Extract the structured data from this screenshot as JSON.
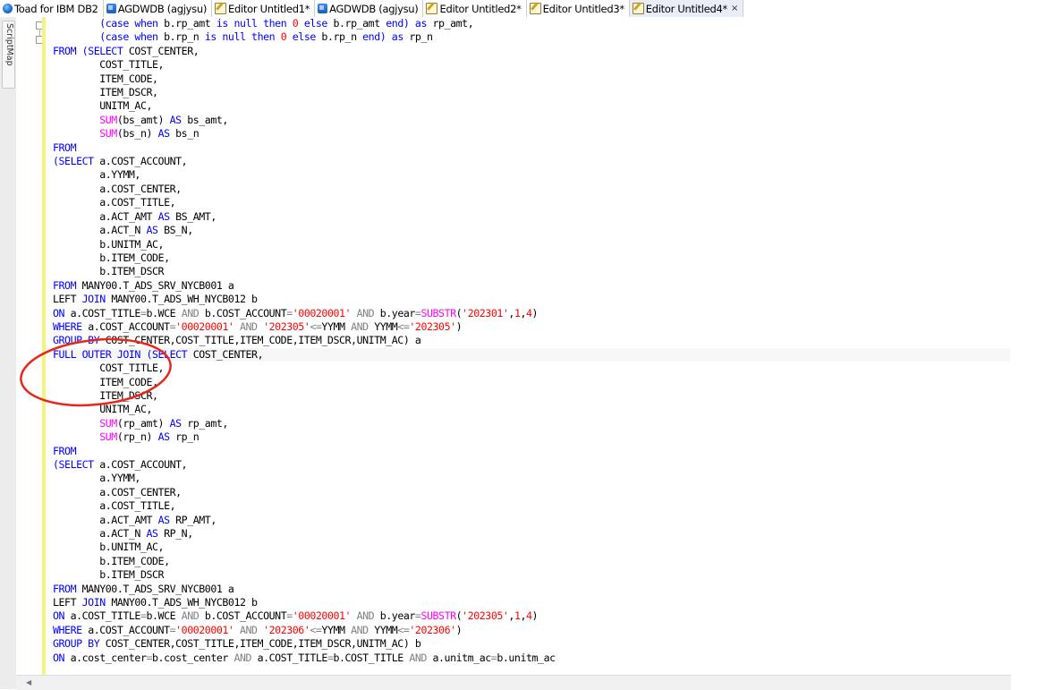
{
  "tabs": [
    {
      "label": "Toad for IBM DB2",
      "icon": "toad-globe-icon",
      "active": false
    },
    {
      "label": "AGDWDB (agjysu)",
      "icon": "database-connection-icon",
      "active": false
    },
    {
      "label": "Editor Untitled1*",
      "icon": "editor-icon",
      "active": false
    },
    {
      "label": "AGDWDB (agjysu)",
      "icon": "database-connection-icon",
      "active": false
    },
    {
      "label": "Editor Untitled2*",
      "icon": "editor-icon",
      "active": false
    },
    {
      "label": "Editor Untitled3*",
      "icon": "editor-icon",
      "active": false
    },
    {
      "label": "Editor Untitled4*",
      "icon": "editor-icon",
      "active": true,
      "close": "×"
    }
  ],
  "scriptmap": {
    "label": "ScriptMap"
  },
  "colors": {
    "keyword": "#0000ff",
    "function": "#ff00ff",
    "string": "#ff0000",
    "number": "#ff0000",
    "operator": "#808080",
    "annotation": "#e8261a",
    "change_bar": "#f5f47a"
  },
  "code": [
    [
      [
        "p",
        "        "
      ],
      [
        "k",
        "(case when "
      ],
      [
        "t",
        "b.rp_amt "
      ],
      [
        "k",
        "is null then "
      ],
      [
        "n",
        "0"
      ],
      [
        "k",
        " else "
      ],
      [
        "t",
        "b.rp_amt "
      ],
      [
        "k",
        "end) as "
      ],
      [
        "t",
        "rp_amt,"
      ]
    ],
    [
      [
        "p",
        "        "
      ],
      [
        "k",
        "(case when "
      ],
      [
        "t",
        "b.rp_n "
      ],
      [
        "k",
        "is null then "
      ],
      [
        "n",
        "0"
      ],
      [
        "k",
        " else "
      ],
      [
        "t",
        "b.rp_n "
      ],
      [
        "k",
        "end) as "
      ],
      [
        "t",
        "rp_n"
      ]
    ],
    [
      [
        "k",
        "FROM "
      ],
      [
        "k",
        "("
      ],
      [
        "k",
        "SELECT "
      ],
      [
        "t",
        "COST_CENTER,"
      ]
    ],
    [
      [
        "p",
        "        "
      ],
      [
        "t",
        "COST_TITLE,"
      ]
    ],
    [
      [
        "p",
        "        "
      ],
      [
        "t",
        "ITEM_CODE,"
      ]
    ],
    [
      [
        "p",
        "        "
      ],
      [
        "t",
        "ITEM_DSCR,"
      ]
    ],
    [
      [
        "p",
        "        "
      ],
      [
        "t",
        "UNITM_AC,"
      ]
    ],
    [
      [
        "p",
        "        "
      ],
      [
        "f",
        "SUM"
      ],
      [
        "t",
        "(bs_amt) "
      ],
      [
        "k",
        "AS "
      ],
      [
        "t",
        "bs_amt,"
      ]
    ],
    [
      [
        "p",
        "        "
      ],
      [
        "f",
        "SUM"
      ],
      [
        "t",
        "(bs_n) "
      ],
      [
        "k",
        "AS "
      ],
      [
        "t",
        "bs_n"
      ]
    ],
    [
      [
        "k",
        "FROM"
      ]
    ],
    [
      [
        "k",
        "(SELECT "
      ],
      [
        "t",
        "a.COST_ACCOUNT,"
      ]
    ],
    [
      [
        "p",
        "        "
      ],
      [
        "t",
        "a.YYMM,"
      ]
    ],
    [
      [
        "p",
        "        "
      ],
      [
        "t",
        "a.COST_CENTER,"
      ]
    ],
    [
      [
        "p",
        "        "
      ],
      [
        "t",
        "a.COST_TITLE,"
      ]
    ],
    [
      [
        "p",
        "        "
      ],
      [
        "t",
        "a.ACT_AMT "
      ],
      [
        "k",
        "AS "
      ],
      [
        "t",
        "BS_AMT,"
      ]
    ],
    [
      [
        "p",
        "        "
      ],
      [
        "t",
        "a.ACT_N "
      ],
      [
        "k",
        "AS "
      ],
      [
        "t",
        "BS_N,"
      ]
    ],
    [
      [
        "p",
        "        "
      ],
      [
        "t",
        "b.UNITM_AC,"
      ]
    ],
    [
      [
        "p",
        "        "
      ],
      [
        "t",
        "b.ITEM_CODE,"
      ]
    ],
    [
      [
        "p",
        "        "
      ],
      [
        "t",
        "b.ITEM_DSCR"
      ]
    ],
    [
      [
        "k",
        "FROM "
      ],
      [
        "t",
        "MANY00.T_ADS_SRV_NYCB001 a"
      ]
    ],
    [
      [
        "t",
        "LEFT "
      ],
      [
        "k",
        "JOIN "
      ],
      [
        "t",
        "MANY00.T_ADS_WH_NYCB012 b"
      ]
    ],
    [
      [
        "k",
        "ON "
      ],
      [
        "t",
        "a.COST_TITLE"
      ],
      [
        "o",
        "="
      ],
      [
        "t",
        "b.WCE "
      ],
      [
        "o",
        "AND "
      ],
      [
        "t",
        "b.COST_ACCOUNT"
      ],
      [
        "o",
        "="
      ],
      [
        "s",
        "'00020001'"
      ],
      [
        "o",
        " AND "
      ],
      [
        "t",
        "b.year"
      ],
      [
        "o",
        "="
      ],
      [
        "f",
        "SUBSTR"
      ],
      [
        "t",
        "("
      ],
      [
        "s",
        "'202301'"
      ],
      [
        "t",
        ","
      ],
      [
        "n",
        "1"
      ],
      [
        "t",
        ","
      ],
      [
        "n",
        "4"
      ],
      [
        "t",
        ")"
      ]
    ],
    [
      [
        "k",
        "WHERE "
      ],
      [
        "t",
        "a.COST_ACCOUNT"
      ],
      [
        "o",
        "="
      ],
      [
        "s",
        "'00020001'"
      ],
      [
        "o",
        " AND "
      ],
      [
        "s",
        "'202305'"
      ],
      [
        "o",
        "<="
      ],
      [
        "t",
        "YYMM "
      ],
      [
        "o",
        "AND "
      ],
      [
        "t",
        "YYMM"
      ],
      [
        "o",
        "<="
      ],
      [
        "s",
        "'202305'"
      ],
      [
        "t",
        ")"
      ]
    ],
    [
      [
        "k",
        "GROUP BY "
      ],
      [
        "t",
        "COST_CENTER,COST_TITLE,ITEM_CODE,ITEM_DSCR,UNITM_AC) a"
      ]
    ],
    [
      [
        "k",
        "FULL OUTER JOIN "
      ],
      [
        "k",
        "(SELECT "
      ],
      [
        "t",
        "COST_CENTER,"
      ]
    ],
    [
      [
        "p",
        "        "
      ],
      [
        "t",
        "COST_TITLE,"
      ]
    ],
    [
      [
        "p",
        "        "
      ],
      [
        "t",
        "ITEM_CODE,"
      ]
    ],
    [
      [
        "p",
        "        "
      ],
      [
        "t",
        "ITEM_DSCR,"
      ]
    ],
    [
      [
        "p",
        "        "
      ],
      [
        "t",
        "UNITM_AC,"
      ]
    ],
    [
      [
        "p",
        "        "
      ],
      [
        "f",
        "SUM"
      ],
      [
        "t",
        "(rp_amt) "
      ],
      [
        "k",
        "AS "
      ],
      [
        "t",
        "rp_amt,"
      ]
    ],
    [
      [
        "p",
        "        "
      ],
      [
        "f",
        "SUM"
      ],
      [
        "t",
        "(rp_n) "
      ],
      [
        "k",
        "AS "
      ],
      [
        "t",
        "rp_n"
      ]
    ],
    [
      [
        "k",
        "FROM"
      ]
    ],
    [
      [
        "k",
        "(SELECT "
      ],
      [
        "t",
        "a.COST_ACCOUNT,"
      ]
    ],
    [
      [
        "p",
        "        "
      ],
      [
        "t",
        "a.YYMM,"
      ]
    ],
    [
      [
        "p",
        "        "
      ],
      [
        "t",
        "a.COST_CENTER,"
      ]
    ],
    [
      [
        "p",
        "        "
      ],
      [
        "t",
        "a.COST_TITLE,"
      ]
    ],
    [
      [
        "p",
        "        "
      ],
      [
        "t",
        "a.ACT_AMT "
      ],
      [
        "k",
        "AS "
      ],
      [
        "t",
        "RP_AMT,"
      ]
    ],
    [
      [
        "p",
        "        "
      ],
      [
        "t",
        "a.ACT_N "
      ],
      [
        "k",
        "AS "
      ],
      [
        "t",
        "RP_N,"
      ]
    ],
    [
      [
        "p",
        "        "
      ],
      [
        "t",
        "b.UNITM_AC,"
      ]
    ],
    [
      [
        "p",
        "        "
      ],
      [
        "t",
        "b.ITEM_CODE,"
      ]
    ],
    [
      [
        "p",
        "        "
      ],
      [
        "t",
        "b.ITEM_DSCR"
      ]
    ],
    [
      [
        "k",
        "FROM "
      ],
      [
        "t",
        "MANY00.T_ADS_SRV_NYCB001 a"
      ]
    ],
    [
      [
        "t",
        "LEFT "
      ],
      [
        "k",
        "JOIN "
      ],
      [
        "t",
        "MANY00.T_ADS_WH_NYCB012 b"
      ]
    ],
    [
      [
        "k",
        "ON "
      ],
      [
        "t",
        "a.COST_TITLE"
      ],
      [
        "o",
        "="
      ],
      [
        "t",
        "b.WCE "
      ],
      [
        "o",
        "AND "
      ],
      [
        "t",
        "b.COST_ACCOUNT"
      ],
      [
        "o",
        "="
      ],
      [
        "s",
        "'00020001'"
      ],
      [
        "o",
        " AND "
      ],
      [
        "t",
        "b.year"
      ],
      [
        "o",
        "="
      ],
      [
        "f",
        "SUBSTR"
      ],
      [
        "t",
        "("
      ],
      [
        "s",
        "'202305'"
      ],
      [
        "t",
        ","
      ],
      [
        "n",
        "1"
      ],
      [
        "t",
        ","
      ],
      [
        "n",
        "4"
      ],
      [
        "t",
        ")"
      ]
    ],
    [
      [
        "k",
        "WHERE "
      ],
      [
        "t",
        "a.COST_ACCOUNT"
      ],
      [
        "o",
        "="
      ],
      [
        "s",
        "'00020001'"
      ],
      [
        "o",
        " AND "
      ],
      [
        "s",
        "'202306'"
      ],
      [
        "o",
        "<="
      ],
      [
        "t",
        "YYMM "
      ],
      [
        "o",
        "AND "
      ],
      [
        "t",
        "YYMM"
      ],
      [
        "o",
        "<="
      ],
      [
        "s",
        "'202306'"
      ],
      [
        "t",
        ")"
      ]
    ],
    [
      [
        "k",
        "GROUP BY "
      ],
      [
        "t",
        "COST_CENTER,COST_TITLE,ITEM_CODE,ITEM_DSCR,UNITM_AC) b"
      ]
    ],
    [
      [
        "k",
        "ON "
      ],
      [
        "t",
        "a.cost_center"
      ],
      [
        "o",
        "="
      ],
      [
        "t",
        "b.cost_center "
      ],
      [
        "o",
        "AND "
      ],
      [
        "t",
        "a.COST_TITLE"
      ],
      [
        "o",
        "="
      ],
      [
        "t",
        "b.COST_TITLE "
      ],
      [
        "o",
        "AND "
      ],
      [
        "t",
        "a.unitm_ac"
      ],
      [
        "o",
        "="
      ],
      [
        "t",
        "b.unitm_ac"
      ]
    ]
  ]
}
